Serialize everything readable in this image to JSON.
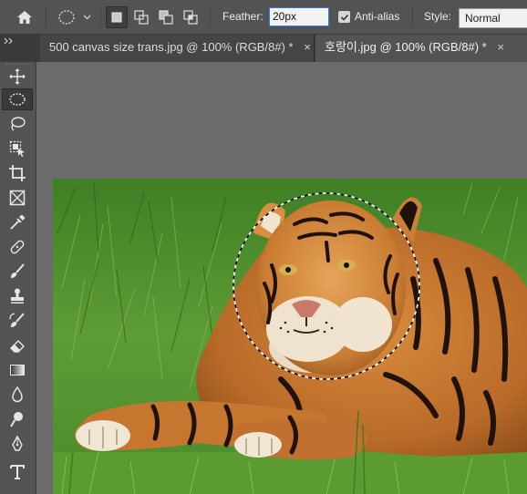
{
  "options_bar": {
    "feather_label": "Feather:",
    "feather_value": "20px",
    "antialias_label": "Anti-alias",
    "antialias_checked": true,
    "style_label": "Style:",
    "style_value": "Normal"
  },
  "tabs": [
    {
      "label": "500 canvas size trans.jpg @ 100% (RGB/8#) *",
      "close": "×",
      "active": false
    },
    {
      "label": "호랑이.jpg @ 100% (RGB/8#) *",
      "close": "×",
      "active": true
    }
  ],
  "tools": [
    {
      "name": "move-tool",
      "icon": "move-icon"
    },
    {
      "name": "elliptical-marquee-tool",
      "icon": "ellipse-marquee-icon",
      "active": true
    },
    {
      "name": "lasso-tool",
      "icon": "lasso-icon"
    },
    {
      "name": "object-selection-tool",
      "icon": "object-selection-icon"
    },
    {
      "name": "crop-tool",
      "icon": "crop-icon"
    },
    {
      "name": "frame-tool",
      "icon": "frame-icon"
    },
    {
      "name": "eyedropper-tool",
      "icon": "eyedropper-icon"
    },
    {
      "name": "healing-brush-tool",
      "icon": "bandage-icon"
    },
    {
      "name": "brush-tool",
      "icon": "brush-icon"
    },
    {
      "name": "clone-stamp-tool",
      "icon": "stamp-icon"
    },
    {
      "name": "history-brush-tool",
      "icon": "history-brush-icon"
    },
    {
      "name": "eraser-tool",
      "icon": "eraser-icon"
    },
    {
      "name": "gradient-tool",
      "icon": "gradient-icon"
    },
    {
      "name": "blur-tool",
      "icon": "drop-icon"
    },
    {
      "name": "dodge-tool",
      "icon": "dodge-icon"
    },
    {
      "name": "pen-tool",
      "icon": "pen-icon"
    },
    {
      "name": "type-tool",
      "icon": "type-icon"
    }
  ],
  "colors": {
    "accent": "#2f7fd6",
    "panel": "#535353",
    "workspace": "#6b6b6b",
    "tiger_orange": "#c8782f",
    "grass_green": "#5d9a33"
  }
}
